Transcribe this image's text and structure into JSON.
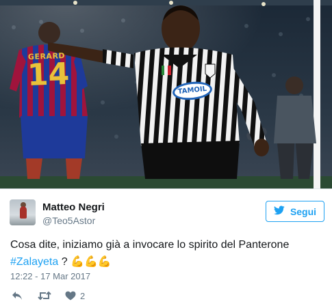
{
  "photo": {
    "jersey_name": "GERARD",
    "jersey_number": "14",
    "sponsor_text": "TAMOIL"
  },
  "tweet": {
    "author": {
      "name": "Matteo Negri",
      "handle": "@Teo5Astor"
    },
    "follow_label": "Segui",
    "text_prefix": "Cosa dite, iniziamo già a invocare lo spirito del Panterone",
    "hashtag": "#Zalayeta",
    "text_suffix": " ? ",
    "emojis": "💪💪💪",
    "timestamp": "12:22 - 17 Mar 2017",
    "actions": {
      "like_count": "2"
    }
  },
  "colors": {
    "brand": "#1da1f2",
    "text": "#14171a",
    "muted": "#657786",
    "border": "#e1e8ed"
  },
  "icons": [
    "twitter-bird-icon",
    "reply-icon",
    "retweet-icon",
    "heart-icon"
  ]
}
